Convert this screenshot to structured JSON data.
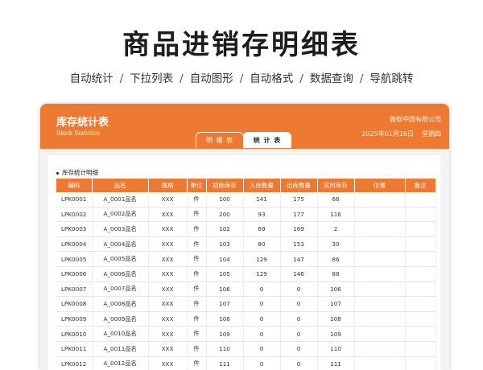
{
  "page": {
    "title": "商品进销存明细表",
    "features": [
      "自动统计",
      "下拉列表",
      "自动图形",
      "自动格式",
      "数据查询",
      "导航跳转"
    ],
    "separator": "/"
  },
  "app": {
    "title": "库存统计表",
    "subtitle": "Stock Statistics",
    "company": "微软中国有限公司",
    "date": "2025年01月16日",
    "weekday": "星期四",
    "accent_color": "#ee7a31",
    "tabs": [
      {
        "label": "明 细 表",
        "active": false
      },
      {
        "label": "统 计 表",
        "active": true
      }
    ]
  },
  "section": {
    "title": "库存统计明细"
  },
  "table": {
    "headers": [
      "编码",
      "品名",
      "规格",
      "单位",
      "初始库存",
      "入库数量",
      "出库数量",
      "实时库存",
      "位置",
      "备注"
    ],
    "rows": [
      {
        "code": "LPK0001",
        "name": "A_0001品名",
        "spec": "XXX",
        "unit": "件",
        "initial": "100",
        "in": "141",
        "out": "175",
        "current": "66",
        "location": "",
        "remark": ""
      },
      {
        "code": "LPK0002",
        "name": "A_0002品名",
        "spec": "XXX",
        "unit": "件",
        "initial": "200",
        "in": "93",
        "out": "177",
        "current": "116",
        "location": "",
        "remark": ""
      },
      {
        "code": "LPK0003",
        "name": "A_0003品名",
        "spec": "XXX",
        "unit": "件",
        "initial": "102",
        "in": "69",
        "out": "169",
        "current": "2",
        "location": "",
        "remark": ""
      },
      {
        "code": "LPK0004",
        "name": "A_0004品名",
        "spec": "XXX",
        "unit": "件",
        "initial": "103",
        "in": "80",
        "out": "153",
        "current": "30",
        "location": "",
        "remark": ""
      },
      {
        "code": "LPK0005",
        "name": "A_0005品名",
        "spec": "XXX",
        "unit": "件",
        "initial": "104",
        "in": "129",
        "out": "147",
        "current": "86",
        "location": "",
        "remark": ""
      },
      {
        "code": "LPK0006",
        "name": "A_0006品名",
        "spec": "XXX",
        "unit": "件",
        "initial": "105",
        "in": "129",
        "out": "146",
        "current": "88",
        "location": "",
        "remark": ""
      },
      {
        "code": "LPK0007",
        "name": "A_0007品名",
        "spec": "XXX",
        "unit": "件",
        "initial": "106",
        "in": "0",
        "out": "0",
        "current": "106",
        "location": "",
        "remark": ""
      },
      {
        "code": "LPK0008",
        "name": "A_0008品名",
        "spec": "XXX",
        "unit": "件",
        "initial": "107",
        "in": "0",
        "out": "0",
        "current": "107",
        "location": "",
        "remark": ""
      },
      {
        "code": "LPK0009",
        "name": "A_0009品名",
        "spec": "XXX",
        "unit": "件",
        "initial": "108",
        "in": "0",
        "out": "0",
        "current": "108",
        "location": "",
        "remark": ""
      },
      {
        "code": "LPK0010",
        "name": "A_0010品名",
        "spec": "XXX",
        "unit": "件",
        "initial": "109",
        "in": "0",
        "out": "0",
        "current": "109",
        "location": "",
        "remark": ""
      },
      {
        "code": "LPK0011",
        "name": "A_0011品名",
        "spec": "XXX",
        "unit": "件",
        "initial": "110",
        "in": "0",
        "out": "0",
        "current": "110",
        "location": "",
        "remark": ""
      },
      {
        "code": "LPK0012",
        "name": "A_0012品名",
        "spec": "XXX",
        "unit": "件",
        "initial": "111",
        "in": "0",
        "out": "0",
        "current": "111",
        "location": "",
        "remark": ""
      }
    ]
  }
}
